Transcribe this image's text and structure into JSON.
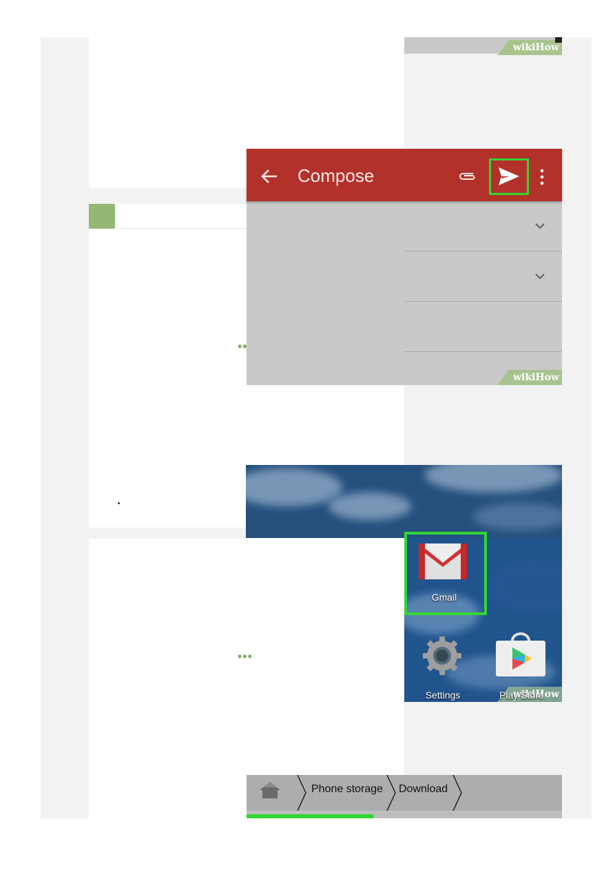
{
  "brand": {
    "watermark_part1": "wiki",
    "watermark_part2": "How",
    "accent_green": "#93b874",
    "highlight_green": "#33d633"
  },
  "compose_screen": {
    "title": "Compose",
    "app_bar_color": "#b2312a",
    "icons": [
      "back-arrow-icon",
      "paperclip-icon",
      "send-icon",
      "more-vert-icon",
      "chevron-down-icon"
    ]
  },
  "home_screen": {
    "apps": [
      {
        "label": "Gmail",
        "icon": "gmail-icon"
      },
      {
        "label": "Settings",
        "icon": "settings-icon"
      },
      {
        "label": "Play Store",
        "icon": "play-store-icon"
      }
    ]
  },
  "file_manager": {
    "breadcrumb": [
      "Phone storage",
      "Download"
    ],
    "icons": [
      "home-icon"
    ]
  },
  "placeholders": {
    "more_indicator": "•••"
  }
}
